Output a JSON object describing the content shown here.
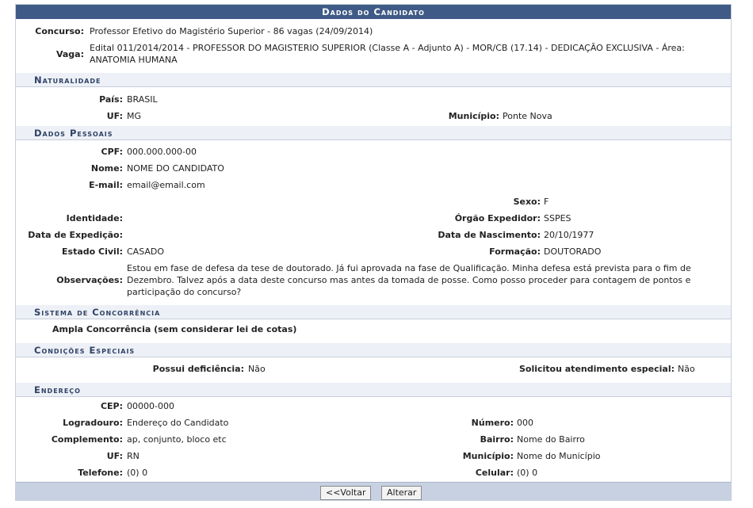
{
  "title": "Dados do Candidato",
  "concurso": {
    "label": "Concurso:",
    "value": "Professor Efetivo do Magistério Superior - 86 vagas (24/09/2014)"
  },
  "vaga": {
    "label": "Vaga:",
    "value": "Edital 011/2014/2014 - PROFESSOR DO MAGISTERIO SUPERIOR (Classe A - Adjunto A) - MOR/CB (17.14) - DEDICAÇÃO EXCLUSIVA - Área: ANATOMIA HUMANA"
  },
  "naturalidade": {
    "title": "Naturalidade",
    "pais_label": "País:",
    "pais": "BRASIL",
    "uf_label": "UF:",
    "uf": "MG",
    "municipio_label": "Município:",
    "municipio": "Ponte Nova"
  },
  "dados_pessoais": {
    "title": "Dados Pessoais",
    "cpf_label": "CPF:",
    "cpf": "000.000.000-00",
    "nome_label": "Nome:",
    "nome": "NOME DO CANDIDATO",
    "email_label": "E-mail:",
    "email": "email@email.com",
    "sexo_label": "Sexo:",
    "sexo": "F",
    "identidade_label": "Identidade:",
    "identidade": "",
    "orgao_label": "Órgão Expedidor:",
    "orgao": "SSPES",
    "data_exp_label": "Data de Expedição:",
    "data_exp": "",
    "nascimento_label": "Data de Nascimento:",
    "nascimento": "20/10/1977",
    "estado_civil_label": "Estado Civil:",
    "estado_civil": "CASADO",
    "formacao_label": "Formação:",
    "formacao": "DOUTORADO",
    "observacoes_label": "Observações:",
    "observacoes": "Estou em fase de defesa da tese de doutorado. Já fui aprovada na fase de Qualificação. Minha defesa está prevista para o fim de Dezembro. Talvez após a data deste concurso mas antes da tomada de posse. Como posso proceder para contagem de pontos e participação do concurso?"
  },
  "sistema": {
    "title": "Sistema de Concorrência",
    "value": "Ampla Concorrência (sem considerar lei de cotas)"
  },
  "condicoes": {
    "title": "Condições Especiais",
    "deficiencia_label": "Possui deficiência:",
    "deficiencia": "Não",
    "atendimento_label": "Solicitou atendimento especial:",
    "atendimento": "Não"
  },
  "endereco": {
    "title": "Endereço",
    "cep_label": "CEP:",
    "cep": "00000-000",
    "logradouro_label": "Logradouro:",
    "logradouro": "Endereço do Candidato",
    "numero_label": "Número:",
    "numero": "000",
    "complemento_label": "Complemento:",
    "complemento": "ap, conjunto, bloco etc",
    "bairro_label": "Bairro:",
    "bairro": "Nome do Bairro",
    "uf_label": "UF:",
    "uf": "RN",
    "municipio_label": "Município:",
    "municipio": "Nome do Município",
    "telefone_label": "Telefone:",
    "telefone": "(0) 0",
    "celular_label": "Celular:",
    "celular": "(0) 0"
  },
  "buttons": {
    "voltar": "<<Voltar",
    "alterar": "Alterar"
  }
}
